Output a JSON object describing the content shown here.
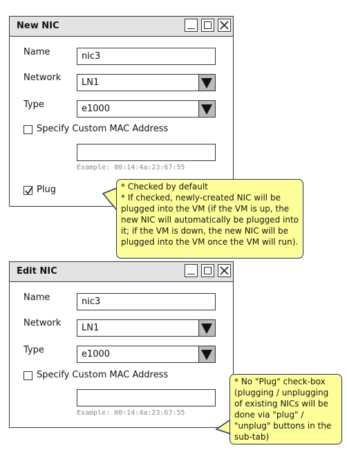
{
  "new_dialog": {
    "title": "New NIC",
    "name_label": "Name",
    "name_value": "nic3",
    "network_label": "Network",
    "network_value": "LN1",
    "type_label": "Type",
    "type_value": "e1000",
    "mac_checkbox_label": "Specify Custom MAC Address",
    "mac_checked": false,
    "mac_value": "",
    "mac_example": "Example: 00:14:4a:23:67:55",
    "plug_label": "Plug",
    "plug_checked": true
  },
  "edit_dialog": {
    "title": "Edit NIC",
    "name_label": "Name",
    "name_value": "nic3",
    "network_label": "Network",
    "network_value": "LN1",
    "type_label": "Type",
    "type_value": "e1000",
    "mac_checkbox_label": "Specify Custom MAC Address",
    "mac_checked": false,
    "mac_value": "",
    "mac_example": "Example: 00:14:4a:23:67:55"
  },
  "notes": {
    "plug_note": "* Checked by default\n* If checked, newly-created NIC will be plugged into the VM (if the VM is up, the new NIC will automatically be plugged into it; if the VM is down, the new NIC will be plugged into the VM once the VM will run).",
    "edit_note": "* No \"Plug\" check-box (plugging / unplugging of existing NICs will be done via \"plug\" / \"unplug\" buttons in the sub-tab)"
  },
  "colors": {
    "note_fill": "#ffff99",
    "note_border": "#23305c",
    "titlebar": "#e3e3e3",
    "select_arrow": "#bbbbbb"
  },
  "icons": [
    "minimize-icon",
    "maximize-icon",
    "close-icon",
    "dropdown-arrow-icon",
    "checkmark-icon"
  ]
}
